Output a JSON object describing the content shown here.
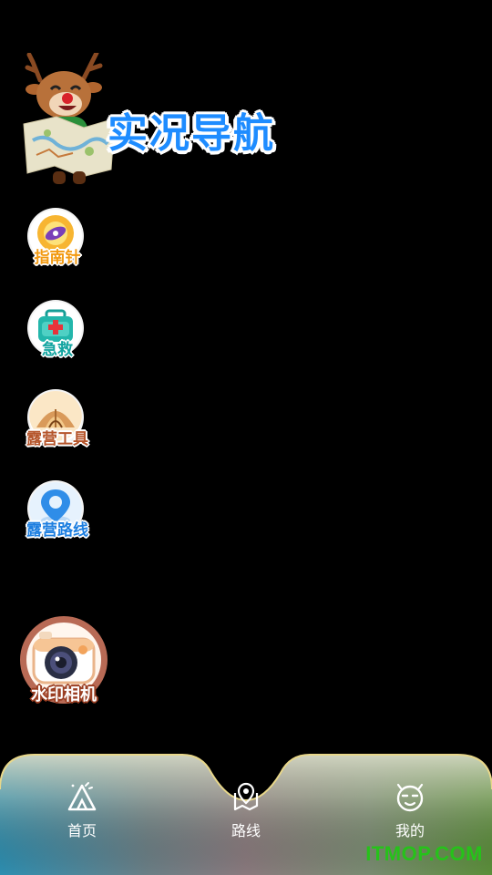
{
  "header": {
    "title": "实况导航"
  },
  "tools": [
    {
      "label": "指南针"
    },
    {
      "label": "急救"
    },
    {
      "label": "露营工具"
    },
    {
      "label": "露营路线"
    }
  ],
  "camera": {
    "label": "水印相机"
  },
  "nav": {
    "items": [
      {
        "label": "首页",
        "icon": "tent-icon"
      },
      {
        "label": "路线",
        "icon": "map-pin-icon"
      },
      {
        "label": "我的",
        "icon": "face-icon"
      }
    ]
  },
  "watermark": "ITMOP.COM",
  "colors": {
    "title": "#1e8cff",
    "background": "#000000",
    "watermark": "#26c21a"
  }
}
